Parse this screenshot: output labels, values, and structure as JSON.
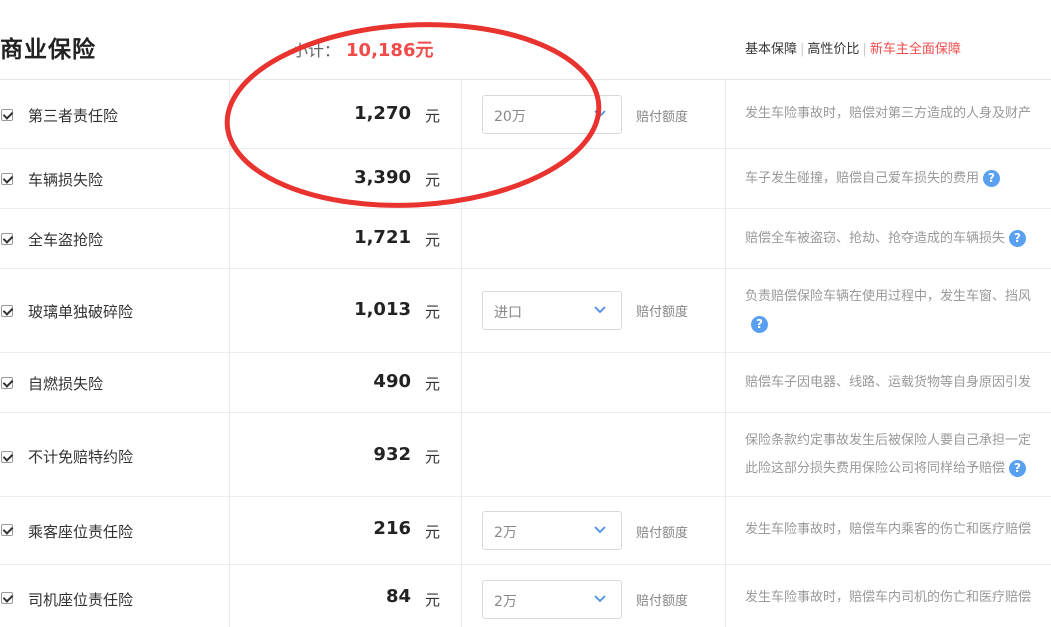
{
  "header": {
    "title": "商业保险",
    "subtotal_label": "小计：",
    "subtotal_value": "10,186元",
    "plans": [
      "基本保障",
      "高性价比",
      "新车主全面保障"
    ]
  },
  "rows": [
    {
      "name": "第三者责任险",
      "amount": "1,270",
      "unit": "元",
      "select": "20万",
      "coverage": "赔付额度",
      "desc": "发生车险事故时，赔偿对第三方造成的人身及财产"
    },
    {
      "name": "车辆损失险",
      "amount": "3,390",
      "unit": "元",
      "desc": "车子发生碰撞，赔偿自己爱车损失的费用"
    },
    {
      "name": "全车盗抢险",
      "amount": "1,721",
      "unit": "元",
      "desc": "赔偿全车被盗窃、抢劫、抢夺造成的车辆损失"
    },
    {
      "name": "玻璃单独破碎险",
      "amount": "1,013",
      "unit": "元",
      "select": "进口",
      "coverage": "赔付额度",
      "desc": "负责赔偿保险车辆在使用过程中，发生车窗、挡风"
    },
    {
      "name": "自燃损失险",
      "amount": "490",
      "unit": "元",
      "desc": "赔偿车子因电器、线路、运载货物等自身原因引发"
    },
    {
      "name": "不计免赔特约险",
      "amount": "932",
      "unit": "元",
      "desc": "保险条款约定事故发生后被保险人要自己承担一定",
      "desc2": "此险这部分损失费用保险公司将同样给予赔偿"
    },
    {
      "name": "乘客座位责任险",
      "amount": "216",
      "unit": "元",
      "select": "2万",
      "coverage": "赔付额度",
      "desc": "发生车险事故时，赔偿车内乘客的伤亡和医疗赔偿"
    },
    {
      "name": "司机座位责任险",
      "amount": "84",
      "unit": "元",
      "select": "2万",
      "coverage": "赔付额度",
      "desc": "发生车险事故时，赔偿车内司机的伤亡和医疗赔偿"
    }
  ],
  "help_icon": "?",
  "colors": {
    "accent": "#f14a4a",
    "help": "#5aa0f0",
    "annotation": "#e8332f"
  }
}
